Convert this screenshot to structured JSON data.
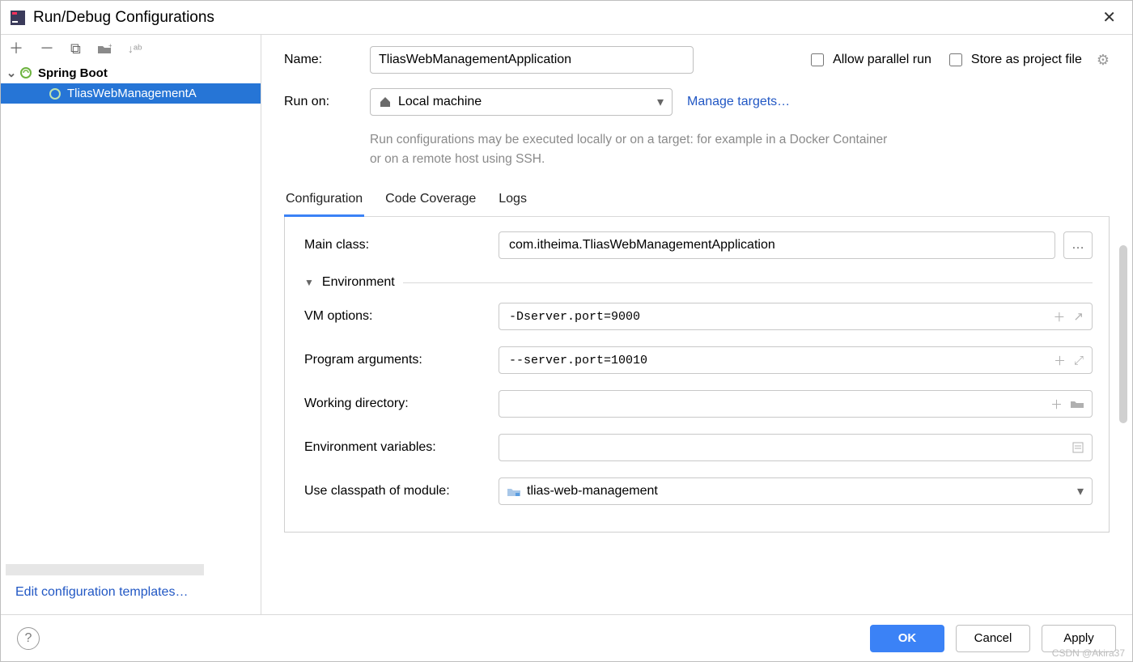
{
  "window": {
    "title": "Run/Debug Configurations"
  },
  "sidebar": {
    "root_label": "Spring Boot",
    "items": [
      {
        "label": "TliasWebManagementA"
      }
    ],
    "edit_templates_label": "Edit configuration templates…"
  },
  "form": {
    "name_label": "Name:",
    "name_value": "TliasWebManagementApplication",
    "allow_parallel_label": "Allow parallel run",
    "store_as_file_label": "Store as project file",
    "run_on_label": "Run on:",
    "run_on_value": "Local machine",
    "manage_targets_label": "Manage targets…",
    "hint": "Run configurations may be executed locally or on a target: for example in a Docker Container or on a remote host using SSH."
  },
  "tabs": [
    {
      "label": "Configuration",
      "active": true
    },
    {
      "label": "Code Coverage",
      "active": false
    },
    {
      "label": "Logs",
      "active": false
    }
  ],
  "config": {
    "main_class_label": "Main class:",
    "main_class_value": "com.itheima.TliasWebManagementApplication",
    "environment_section": "Environment",
    "vm_options_label": "VM options:",
    "vm_options_value": "-Dserver.port=9000",
    "program_args_label": "Program arguments:",
    "program_args_value": "--server.port=10010",
    "working_dir_label": "Working directory:",
    "working_dir_value": "",
    "env_vars_label": "Environment variables:",
    "env_vars_value": "",
    "classpath_label": "Use classpath of module:",
    "classpath_value": "tlias-web-management"
  },
  "footer": {
    "ok": "OK",
    "cancel": "Cancel",
    "apply": "Apply"
  },
  "watermark": "CSDN @Akira37"
}
